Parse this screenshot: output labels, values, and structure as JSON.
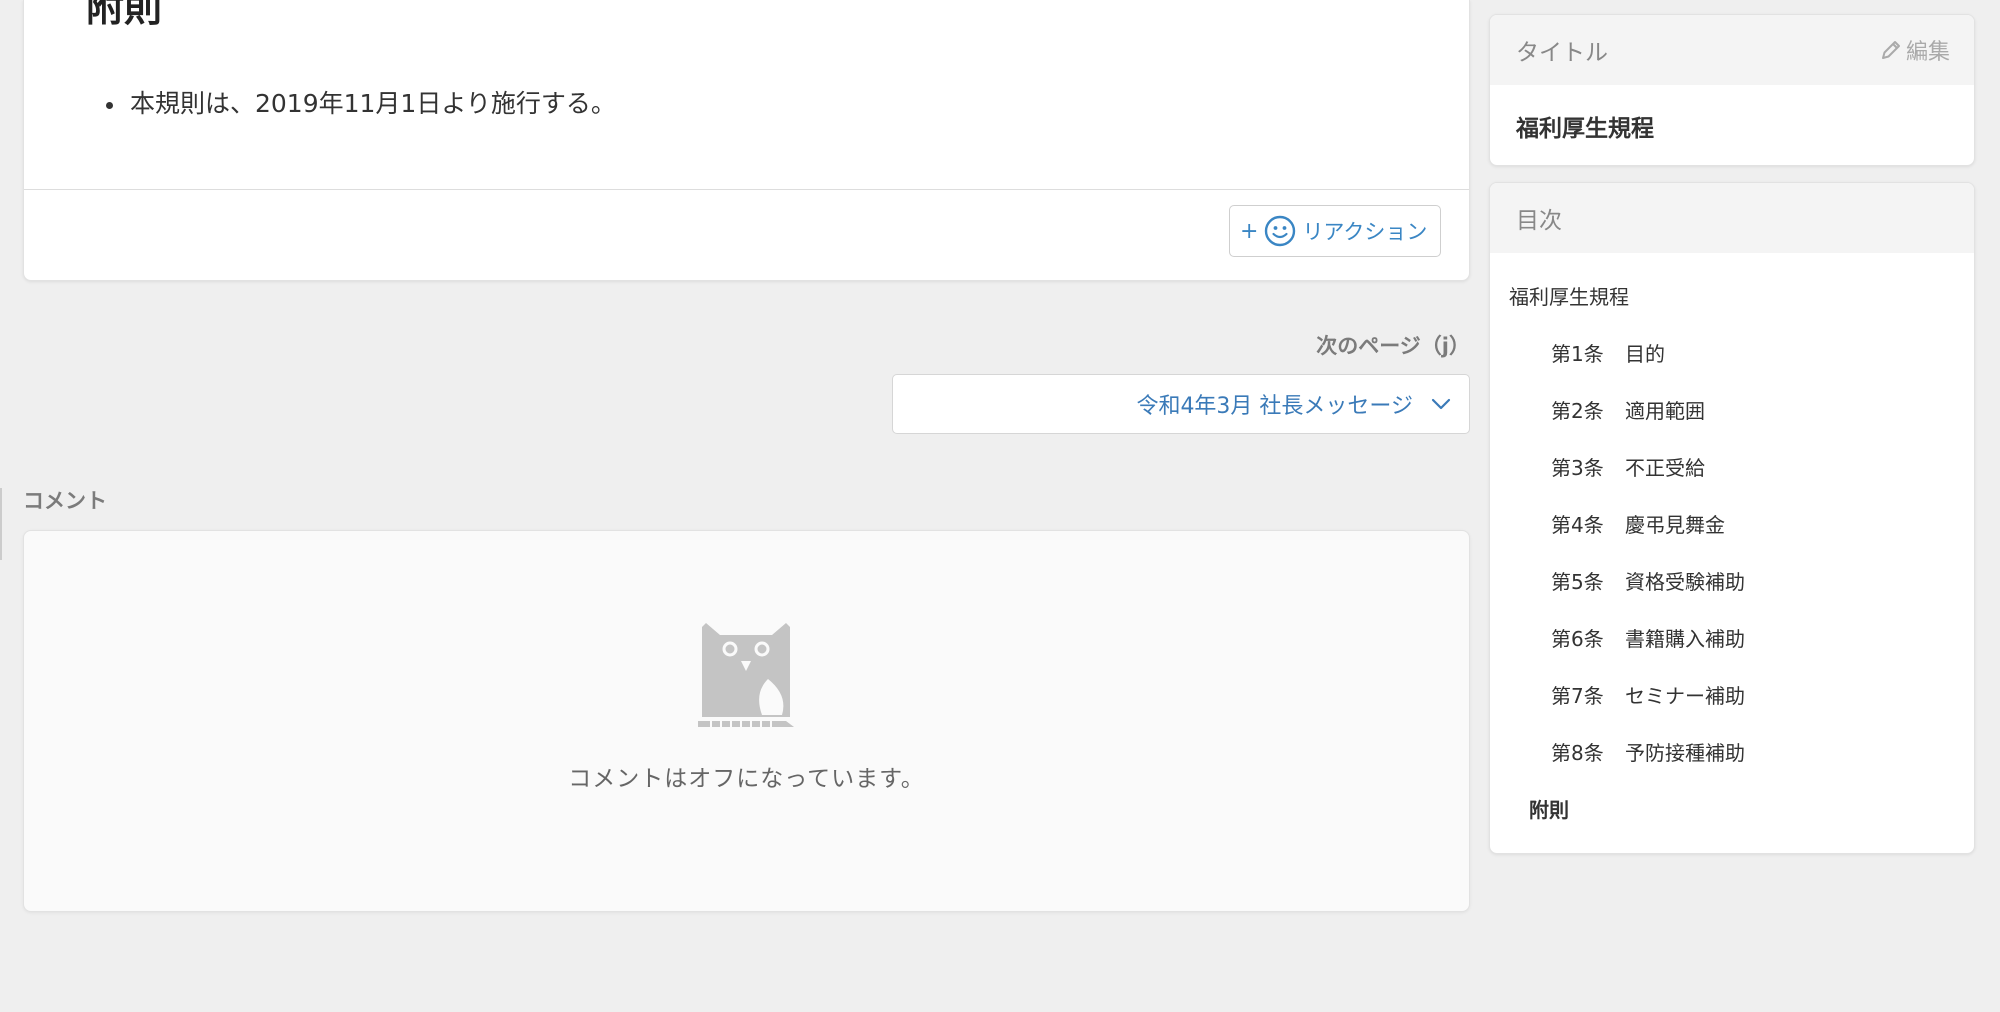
{
  "article": {
    "heading": "附則",
    "items": [
      "本規則は、2019年11月1日より施行する。"
    ],
    "reaction_plus": "+",
    "reaction_label": "リアクション"
  },
  "next_page": {
    "label": "次のページ（j）",
    "selected_title": "令和4年3月 社長メッセージ"
  },
  "comments": {
    "heading": "コメント",
    "status_text": "コメントはオフになっています。"
  },
  "sidebar": {
    "title_card": {
      "header": "タイトル",
      "edit_label": "編集",
      "value": "福利厚生規程"
    },
    "toc": {
      "header": "目次",
      "root": "福利厚生規程",
      "articles": [
        {
          "num": "第1条",
          "name": "目的"
        },
        {
          "num": "第2条",
          "name": "適用範囲"
        },
        {
          "num": "第3条",
          "name": "不正受給"
        },
        {
          "num": "第4条",
          "name": "慶弔見舞金"
        },
        {
          "num": "第5条",
          "name": "資格受験補助"
        },
        {
          "num": "第6条",
          "name": "書籍購入補助"
        },
        {
          "num": "第7条",
          "name": "セミナー補助"
        },
        {
          "num": "第8条",
          "name": "予防接種補助"
        }
      ],
      "appendix": "附則"
    }
  },
  "colors": {
    "accent": "#3a86c4",
    "background": "#efefef",
    "muted_text": "#7b7b7b",
    "owl": "#c4c4c4"
  },
  "icons": [
    "smile-icon",
    "chevron-down-icon",
    "pencil-icon",
    "owl-icon"
  ]
}
